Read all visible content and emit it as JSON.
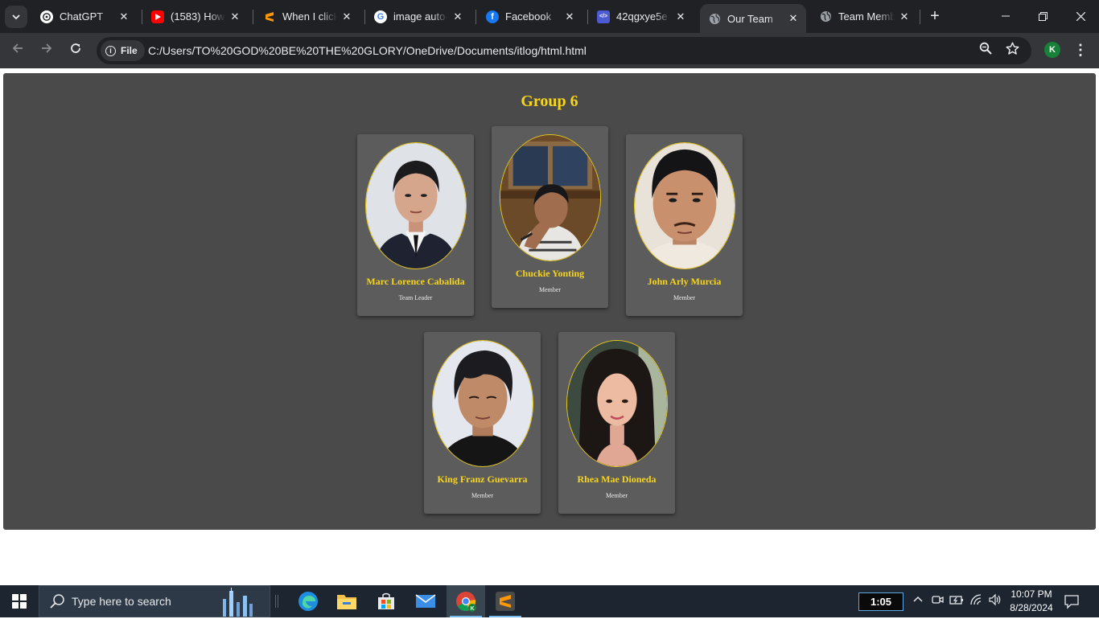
{
  "browser": {
    "tabs": [
      {
        "title": "ChatGPT",
        "icon": "chatgpt-icon",
        "color": "#ffffff"
      },
      {
        "title": "(1583) How T",
        "icon": "youtube-icon",
        "color": "#ff0000"
      },
      {
        "title": "When I click",
        "icon": "sublime-icon",
        "color": "#ff9800"
      },
      {
        "title": "image auto-",
        "icon": "google-icon",
        "color": "#4285f4"
      },
      {
        "title": "Facebook",
        "icon": "facebook-icon",
        "color": "#1877f2"
      },
      {
        "title": "42qgxye5e -",
        "icon": "code-icon",
        "color": "#4c5bd4"
      },
      {
        "title": "Our Team",
        "icon": "globe-icon",
        "color": "#9aa0a6"
      },
      {
        "title": "Team Memb",
        "icon": "globe-icon",
        "color": "#9aa0a6"
      }
    ],
    "active_tab": 6,
    "address": {
      "chip_label": "File",
      "url": "C:/Users/TO%20GOD%20BE%20THE%20GLORY/OneDrive/Documents/itlog/html.html"
    },
    "profile_initial": "K"
  },
  "page": {
    "title": "Group 6",
    "accent_color": "#f7d51d",
    "members": [
      {
        "name": "Marc Lorence Cabalida",
        "role": "Team Leader"
      },
      {
        "name": "Chuckie Yonting",
        "role": "Member"
      },
      {
        "name": "John Arly Murcia",
        "role": "Member"
      },
      {
        "name": "King Franz Guevarra",
        "role": "Member"
      },
      {
        "name": "Rhea Mae Dioneda",
        "role": "Member"
      }
    ]
  },
  "taskbar": {
    "search_placeholder": "Type here to search",
    "timer": "1:05",
    "time": "10:07 PM",
    "date": "8/28/2024"
  }
}
